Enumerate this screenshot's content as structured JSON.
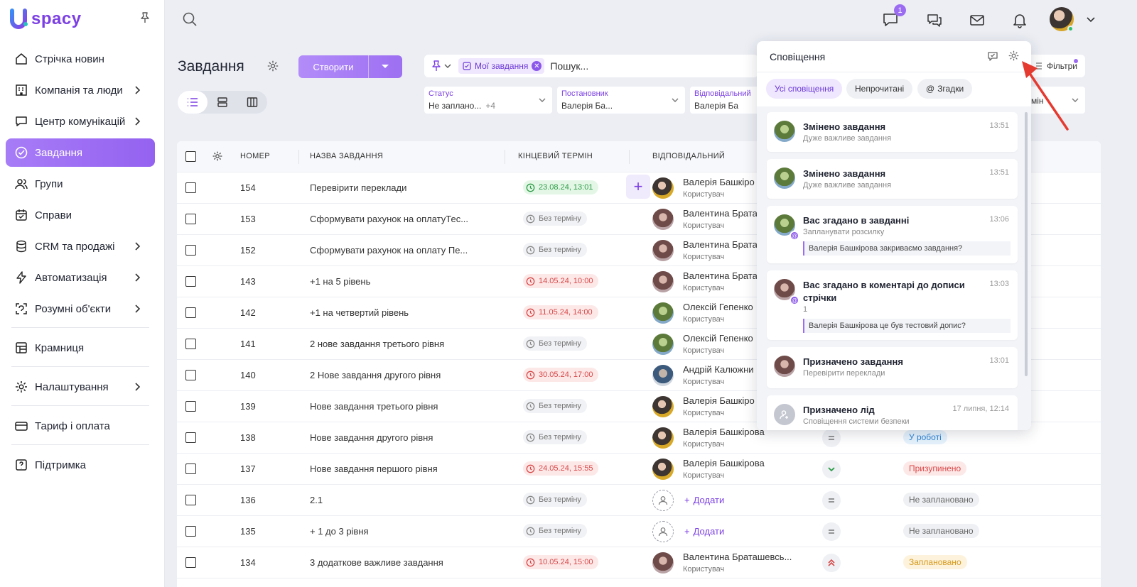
{
  "app": {
    "logo_text": "spacy",
    "colors": {
      "accent": "#9B6CF2",
      "danger": "#D84848",
      "success": "#2A9B45"
    }
  },
  "sidebar": {
    "items": [
      {
        "label": "Стрічка новин",
        "icon": "news-feed-icon",
        "has_submenu": false
      },
      {
        "label": "Компанія та люди",
        "icon": "company-icon",
        "has_submenu": true
      },
      {
        "label": "Центр комунікацій",
        "icon": "chat-icon",
        "has_submenu": true
      },
      {
        "label": "Завдання",
        "icon": "tasks-icon",
        "has_submenu": false,
        "active": true
      },
      {
        "label": "Групи",
        "icon": "groups-icon",
        "has_submenu": false
      },
      {
        "label": "Справи",
        "icon": "calendar-icon",
        "has_submenu": false
      },
      {
        "label": "CRM та продажі",
        "icon": "crm-icon",
        "has_submenu": true
      },
      {
        "label": "Автоматизація",
        "icon": "automation-icon",
        "has_submenu": true
      },
      {
        "label": "Розумні об'єкти",
        "icon": "smart-objects-icon",
        "has_submenu": true
      },
      {
        "label": "Крамниця",
        "icon": "store-icon",
        "has_submenu": false
      },
      {
        "label": "Налаштування",
        "icon": "settings-icon",
        "has_submenu": true
      },
      {
        "label": "Тариф і оплата",
        "icon": "billing-icon",
        "has_submenu": false
      },
      {
        "label": "Підтримка",
        "icon": "support-icon",
        "has_submenu": false
      }
    ]
  },
  "topbar": {
    "chat_badge": "1"
  },
  "page": {
    "title": "Завдання",
    "create_label": "Створити",
    "search": {
      "chip": "Мої завдання",
      "placeholder": "Пошук..."
    },
    "filters_label": "Фільтри",
    "filters": [
      {
        "label": "Статус",
        "value": "Не заплано...",
        "extra": "+4"
      },
      {
        "label": "Постановник",
        "value": "Валерія Ба..."
      },
      {
        "label": "Відповідальний",
        "value": "Валерія Ба"
      }
    ],
    "filter_tail_value": "мін"
  },
  "table": {
    "columns": {
      "number": "НОМЕР",
      "name": "НАЗВА ЗАВДАННЯ",
      "deadline": "КІНЦЕВИЙ ТЕРМІН",
      "responsible": "ВІДПОВІДАЛЬНИЙ"
    },
    "add_label": "Додати",
    "rows": [
      {
        "num": "154",
        "title": "Перевірити переклади",
        "deadline": "23.08.24, 13:01",
        "dl": "ok",
        "resp": "Валерія Башкіро",
        "role": "Користувач",
        "av": "valeria"
      },
      {
        "num": "153",
        "title": "Сформувати рахунок на оплатуТес...",
        "deadline": "Без терміну",
        "dl": "none",
        "resp": "Валентина Брата",
        "role": "Користувач",
        "av": "valentyna"
      },
      {
        "num": "152",
        "title": "Сформувати рахунок на оплату Пе...",
        "deadline": "Без терміну",
        "dl": "none",
        "resp": "Валентина Брата",
        "role": "Користувач",
        "av": "valentyna"
      },
      {
        "num": "143",
        "title": "+1 на 5 рівень",
        "deadline": "14.05.24, 10:00",
        "dl": "late",
        "resp": "Валентина Брата",
        "role": "Користувач",
        "av": "valentyna"
      },
      {
        "num": "142",
        "title": "+1 на четвертий рівень",
        "deadline": "11.05.24, 14:00",
        "dl": "late",
        "resp": "Олексій Гепенко",
        "role": "Користувач",
        "av": "oleksii"
      },
      {
        "num": "141",
        "title": "2 нове завдання третього рівня",
        "deadline": "Без терміну",
        "dl": "none",
        "resp": "Олексій Гепенко",
        "role": "Користувач",
        "av": "oleksii"
      },
      {
        "num": "140",
        "title": "2 Нове завдання другого рівня",
        "deadline": "30.05.24, 17:00",
        "dl": "late",
        "resp": "Андрій Калюжни",
        "role": "Користувач",
        "av": "andrii"
      },
      {
        "num": "139",
        "title": "Нове завдання третього рівня",
        "deadline": "Без терміну",
        "dl": "none",
        "resp": "Валерія Башкіро",
        "role": "Користувач",
        "av": "valeria"
      },
      {
        "num": "138",
        "title": "Нове завдання другого рівня",
        "deadline": "Без терміну",
        "dl": "none",
        "resp": "Валерія Башкірова",
        "role": "Користувач",
        "av": "valeria",
        "prio": "normal",
        "status": "У роботі",
        "st": "work"
      },
      {
        "num": "137",
        "title": "Нове завдання першого рівня",
        "deadline": "24.05.24, 15:55",
        "dl": "late",
        "resp": "Валерія Башкірова",
        "role": "Користувач",
        "av": "valeria",
        "prio": "low",
        "status": "Призупинено",
        "st": "paused"
      },
      {
        "num": "136",
        "title": "2.1",
        "deadline": "Без терміну",
        "dl": "none",
        "resp": "",
        "role": "",
        "av": "empty",
        "prio": "normal",
        "status": "Не заплановано",
        "st": "plan"
      },
      {
        "num": "135",
        "title": "+ 1 до 3 рівня",
        "deadline": "Без терміну",
        "dl": "none",
        "resp": "",
        "role": "",
        "av": "empty",
        "prio": "normal",
        "status": "Не заплановано",
        "st": "plan"
      },
      {
        "num": "134",
        "title": "3 додаткове важливе завдання",
        "deadline": "10.05.24, 15:00",
        "dl": "late",
        "resp": "Валентина Браташевсь...",
        "role": "Користувач",
        "av": "valentyna",
        "prio": "high",
        "status": "Заплановано",
        "st": "planned"
      }
    ]
  },
  "notifications": {
    "title": "Сповіщення",
    "tabs": [
      "Усі сповіщення",
      "Непрочитані",
      "Згадки"
    ],
    "items": [
      {
        "title": "Змінено завдання",
        "time": "13:51",
        "sub": "Дуже важливе завдання",
        "quote": "",
        "av": "oleksii",
        "mention": false
      },
      {
        "title": "Змінено завдання",
        "time": "13:51",
        "sub": "Дуже важливе завдання",
        "quote": "",
        "av": "oleksii",
        "mention": false
      },
      {
        "title": "Вас згадано в завданні",
        "time": "13:06",
        "sub": "Запланувати розсилку",
        "quote": "Валерія Башкірова закриваємо завдання?",
        "av": "oleksii",
        "mention": true
      },
      {
        "title": "Вас згадано в коментарі до дописи стрічки",
        "time": "13:03",
        "sub": "1",
        "quote": "Валерія Башкірова це був тестовий допис?",
        "av": "valentyna",
        "mention": true
      },
      {
        "title": "Призначено завдання",
        "time": "13:01",
        "sub": "Перевірити переклади",
        "quote": "",
        "av": "valentyna",
        "mention": false
      },
      {
        "title": "Призначено лід",
        "time": "17 липня, 12:14",
        "sub": "Сповіщення системи безпеки",
        "quote": "",
        "av": "sys",
        "mention": false
      }
    ]
  }
}
